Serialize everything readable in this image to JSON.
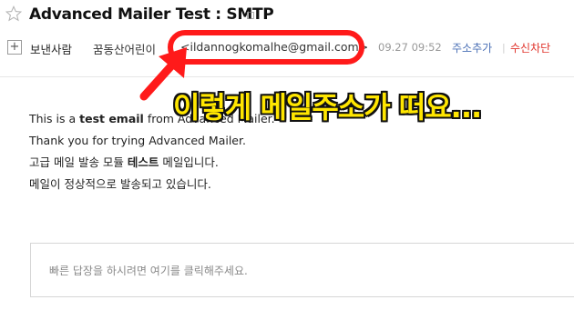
{
  "email": {
    "subject": "Advanced Mailer Test : SMTP",
    "header": {
      "sender_label": "보낸사람",
      "sender_name": "꿈동산어린이",
      "sender_email": "<ildannogkomalhe@gmail.com>",
      "date": "09.27 09:52",
      "add_contact": "주소추가",
      "separator": "|",
      "block_sender": "수신차단"
    },
    "body": {
      "line1_prefix": "This is a ",
      "line1_bold": "test email",
      "line1_suffix": " from Advanced Mailer.",
      "line2": "Thank you for trying Advanced Mailer.",
      "line3_prefix": "고급 메일 발송 모듈 ",
      "line3_bold": "테스트",
      "line3_suffix": " 메일입니다.",
      "line4": "메일이 정상적으로 발송되고 있습니다."
    },
    "reply_placeholder": "빠른 답장을 하시려면 여기를 클릭해주세요."
  },
  "annotation": {
    "text": "이렇게 메일주소가 떠요...",
    "color": "#ffe600",
    "highlight_color": "#ff1a1a"
  },
  "icons": [
    "star-icon",
    "expand-plus-icon",
    "pin-icon",
    "arrow-icon"
  ]
}
